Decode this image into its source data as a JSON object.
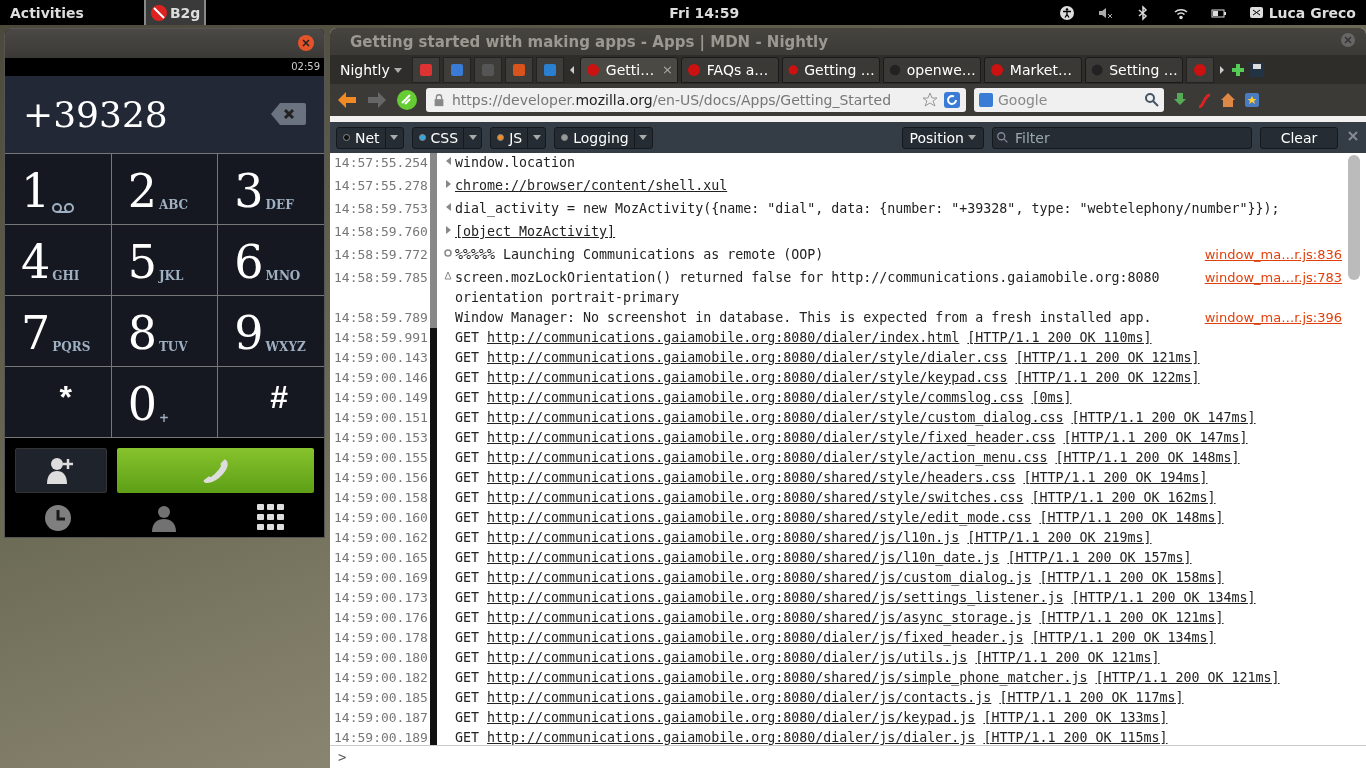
{
  "top_bar": {
    "activities": "Activities",
    "app_menu": "B2g",
    "clock": "Fri 14:59",
    "user": "Luca Greco"
  },
  "phone_window": {
    "status_time": "02:59",
    "number": "+39328",
    "keys": [
      {
        "kind": "digit",
        "digit": "1",
        "voicemail": true
      },
      {
        "kind": "digit",
        "digit": "2",
        "letters": "ABC",
        "voicemail": false
      },
      {
        "kind": "digit",
        "digit": "3",
        "letters": "DEF",
        "voicemail": false
      },
      {
        "kind": "digit",
        "digit": "4",
        "letters": "GHI",
        "voicemail": false
      },
      {
        "kind": "digit",
        "digit": "5",
        "letters": "JKL",
        "voicemail": false
      },
      {
        "kind": "digit",
        "digit": "6",
        "letters": "MNO",
        "voicemail": false
      },
      {
        "kind": "digit",
        "digit": "7",
        "letters": "PQRS",
        "voicemail": false
      },
      {
        "kind": "digit",
        "digit": "8",
        "letters": "TUV",
        "voicemail": false
      },
      {
        "kind": "digit",
        "digit": "9",
        "letters": "WXYZ",
        "voicemail": false
      },
      {
        "kind": "symbol",
        "digit": "*",
        "voicemail": false
      },
      {
        "kind": "digit",
        "digit": "0",
        "letters": "+",
        "voicemail": false
      },
      {
        "kind": "symbol",
        "digit": "#",
        "voicemail": false
      }
    ],
    "bottom_tabs": [
      {
        "kind": "recents",
        "selected": false
      },
      {
        "kind": "contacts",
        "selected": false
      },
      {
        "kind": "keypad",
        "selected": true
      }
    ]
  },
  "browser": {
    "title": "Getting started with making apps - Apps | MDN - Nightly",
    "menu_button": "Nightly",
    "tabs": [
      {
        "label": "Getti…",
        "selected": true,
        "close": "×"
      },
      {
        "label": "FAQs a…",
        "selected": false
      },
      {
        "label": "Getting …",
        "selected": false
      },
      {
        "label": "openwe…",
        "selected": false
      },
      {
        "label": "Market…",
        "selected": false
      },
      {
        "label": "Setting …",
        "selected": false
      }
    ],
    "url": {
      "prefix": "https://developer.",
      "domain": "mozilla.org",
      "path": "/en-US/docs/Apps/Getting_Started"
    },
    "search": {
      "placeholder": "Google"
    }
  },
  "console": {
    "filters": [
      {
        "label": "Net",
        "color": "#111111"
      },
      {
        "label": "CSS",
        "color": "#2ea8e0"
      },
      {
        "label": "JS",
        "color": "#f28c1c"
      },
      {
        "label": "Logging",
        "color": "#9a9a9a"
      }
    ],
    "position": "Position",
    "filter_placeholder": "Filter",
    "clear": "Clear",
    "rows": [
      {
        "time": "14:57:55.254",
        "kind": "input",
        "text": "window.location"
      },
      {
        "time": "14:57:55.278",
        "kind": "output",
        "text": "chrome://browser/content/shell.xul",
        "link": true
      },
      {
        "time": "14:58:59.753",
        "kind": "input",
        "text": "dial_activity = new MozActivity({name: \"dial\", data: {number: \"+39328\", type: \"webtelephony/number\"}});"
      },
      {
        "time": "14:58:59.760",
        "kind": "output",
        "text": "[object MozActivity]",
        "link": true
      },
      {
        "time": "14:58:59.772",
        "kind": "info",
        "text": "%%%%% Launching Communications as remote (OOP)",
        "source": "window_ma…r.js:836"
      },
      {
        "time": "14:58:59.785",
        "kind": "warn",
        "text": "screen.mozLockOrientation() returned false for http://communications.gaiamobile.org:8080\norientation portrait-primary",
        "source": "window_ma…r.js:783"
      },
      {
        "time": "14:58:59.789",
        "kind": "log",
        "text": "Window Manager: No screenshot in database. This is expected from a fresh installed app.",
        "source": "window_ma…r.js:396"
      },
      {
        "time": "14:58:59.991",
        "kind": "net",
        "method": "GET",
        "url": "http://communications.gaiamobile.org:8080/dialer/index.html",
        "status": "[HTTP/1.1 200 OK 110ms]"
      },
      {
        "time": "14:59:00.143",
        "kind": "net",
        "method": "GET",
        "url": "http://communications.gaiamobile.org:8080/dialer/style/dialer.css",
        "status": "[HTTP/1.1 200 OK 121ms]"
      },
      {
        "time": "14:59:00.146",
        "kind": "net",
        "method": "GET",
        "url": "http://communications.gaiamobile.org:8080/dialer/style/keypad.css",
        "status": "[HTTP/1.1 200 OK 122ms]"
      },
      {
        "time": "14:59:00.149",
        "kind": "net",
        "method": "GET",
        "url": "http://communications.gaiamobile.org:8080/dialer/style/commslog.css",
        "status": "[0ms]"
      },
      {
        "time": "14:59:00.151",
        "kind": "net",
        "method": "GET",
        "url": "http://communications.gaiamobile.org:8080/dialer/style/custom_dialog.css",
        "status": "[HTTP/1.1 200 OK 147ms]"
      },
      {
        "time": "14:59:00.153",
        "kind": "net",
        "method": "GET",
        "url": "http://communications.gaiamobile.org:8080/dialer/style/fixed_header.css",
        "status": "[HTTP/1.1 200 OK 147ms]"
      },
      {
        "time": "14:59:00.155",
        "kind": "net",
        "method": "GET",
        "url": "http://communications.gaiamobile.org:8080/dialer/style/action_menu.css",
        "status": "[HTTP/1.1 200 OK 148ms]"
      },
      {
        "time": "14:59:00.156",
        "kind": "net",
        "method": "GET",
        "url": "http://communications.gaiamobile.org:8080/shared/style/headers.css",
        "status": "[HTTP/1.1 200 OK 194ms]"
      },
      {
        "time": "14:59:00.158",
        "kind": "net",
        "method": "GET",
        "url": "http://communications.gaiamobile.org:8080/shared/style/switches.css",
        "status": "[HTTP/1.1 200 OK 162ms]"
      },
      {
        "time": "14:59:00.160",
        "kind": "net",
        "method": "GET",
        "url": "http://communications.gaiamobile.org:8080/shared/style/edit_mode.css",
        "status": "[HTTP/1.1 200 OK 148ms]"
      },
      {
        "time": "14:59:00.162",
        "kind": "net",
        "method": "GET",
        "url": "http://communications.gaiamobile.org:8080/shared/js/l10n.js",
        "status": "[HTTP/1.1 200 OK 219ms]"
      },
      {
        "time": "14:59:00.165",
        "kind": "net",
        "method": "GET",
        "url": "http://communications.gaiamobile.org:8080/shared/js/l10n_date.js",
        "status": "[HTTP/1.1 200 OK 157ms]"
      },
      {
        "time": "14:59:00.169",
        "kind": "net",
        "method": "GET",
        "url": "http://communications.gaiamobile.org:8080/shared/js/custom_dialog.js",
        "status": "[HTTP/1.1 200 OK 158ms]"
      },
      {
        "time": "14:59:00.173",
        "kind": "net",
        "method": "GET",
        "url": "http://communications.gaiamobile.org:8080/shared/js/settings_listener.js",
        "status": "[HTTP/1.1 200 OK 134ms]"
      },
      {
        "time": "14:59:00.176",
        "kind": "net",
        "method": "GET",
        "url": "http://communications.gaiamobile.org:8080/shared/js/async_storage.js",
        "status": "[HTTP/1.1 200 OK 121ms]"
      },
      {
        "time": "14:59:00.178",
        "kind": "net",
        "method": "GET",
        "url": "http://communications.gaiamobile.org:8080/dialer/js/fixed_header.js",
        "status": "[HTTP/1.1 200 OK 134ms]"
      },
      {
        "time": "14:59:00.180",
        "kind": "net",
        "method": "GET",
        "url": "http://communications.gaiamobile.org:8080/dialer/js/utils.js",
        "status": "[HTTP/1.1 200 OK 121ms]"
      },
      {
        "time": "14:59:00.182",
        "kind": "net",
        "method": "GET",
        "url": "http://communications.gaiamobile.org:8080/shared/js/simple_phone_matcher.js",
        "status": "[HTTP/1.1 200 OK 121ms]"
      },
      {
        "time": "14:59:00.185",
        "kind": "net",
        "method": "GET",
        "url": "http://communications.gaiamobile.org:8080/dialer/js/contacts.js",
        "status": "[HTTP/1.1 200 OK 117ms]"
      },
      {
        "time": "14:59:00.187",
        "kind": "net",
        "method": "GET",
        "url": "http://communications.gaiamobile.org:8080/dialer/js/keypad.js",
        "status": "[HTTP/1.1 200 OK 133ms]"
      },
      {
        "time": "14:59:00.189",
        "kind": "net",
        "method": "GET",
        "url": "http://communications.gaiamobile.org:8080/dialer/js/dialer.js",
        "status": "[HTTP/1.1 200 OK 115ms]"
      }
    ],
    "prompt": ">"
  }
}
